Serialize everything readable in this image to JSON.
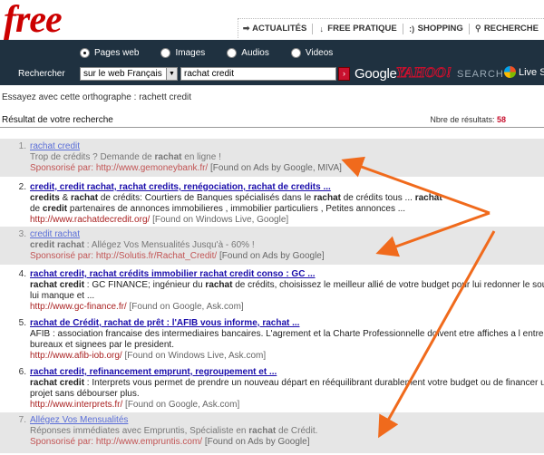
{
  "header": {
    "logo": "free",
    "nav": [
      {
        "icon": "arrow-right-icon",
        "glyph": "➡",
        "label": "ACTUALITÉS"
      },
      {
        "icon": "arrow-down-icon",
        "glyph": "↓",
        "label": "FREE PRATIQUE"
      },
      {
        "icon": "smiley-icon",
        "glyph": ":)",
        "label": "SHOPPING"
      },
      {
        "icon": "pin-icon",
        "glyph": "⚲",
        "label": "RECHERCHE"
      }
    ]
  },
  "search": {
    "tabs": [
      "Pages web",
      "Images",
      "Audios",
      "Videos"
    ],
    "selected_tab": "Pages web",
    "label": "Rechercher",
    "scope": "sur le web Français",
    "query": "rachat credit",
    "go": "›",
    "engines": {
      "google": "Google",
      "yahoo": "YAHOO!",
      "yahoo_search": "SEARCH",
      "live": "Live Se"
    }
  },
  "suggestion": "Essayez avec cette orthographe : rachett credit",
  "results_header": {
    "title": "Résultat de votre recherche",
    "count_label": "Nbre de résultats:",
    "count": "58"
  },
  "results": [
    {
      "num": "1.",
      "sponsored": true,
      "title": "rachat credit",
      "lines": [
        "Trop de crédits ? Demande de <b>rachat</b> en ligne !"
      ],
      "url": "Sponsorisé par: http://www.gemoneybank.fr/",
      "source": "[Found on Ads by Google, MIVA]"
    },
    {
      "num": "2.",
      "sponsored": false,
      "title": "credit, credit rachat, rachat credits, renégociation, rachat de credits ...",
      "lines": [
        "<b>credits</b> &amp; <b>rachat</b> de crédits: Courtiers de Banques spécialisés dans le <b>rachat</b> de crédits tous ... <b>rachat</b>",
        "de <b>credit</b> partenaires de annonces immobilieres , immobilier particuliers , Petites annonces ..."
      ],
      "url": "http://www.rachatdecredit.org/",
      "source": "[Found on Windows Live, Google]"
    },
    {
      "num": "3.",
      "sponsored": true,
      "title": "credit rachat",
      "lines": [
        "<b>credit rachat</b> : Allégez Vos Mensualités Jusqu'à - 60% !"
      ],
      "url": "Sponsorisé par: http://Solutis.fr/Rachat_Credit/",
      "source": "[Found on Ads by Google]"
    },
    {
      "num": "4.",
      "sponsored": false,
      "title": "rachat credit, rachat crédits immobilier rachat credit conso : GC ...",
      "lines": [
        "<b>rachat credit</b> : GC FINANCE; ingénieur du <b>rachat</b> de crédits, choisissez le meilleur allié de votre budget pour lui redonner le souffle qu'il",
        "lui manque et ..."
      ],
      "url": "http://www.gc-finance.fr/",
      "source": "[Found on Google, Ask.com]"
    },
    {
      "num": "5.",
      "sponsored": false,
      "title": "rachat de Crédit, rachat de prêt : l'AFIB vous informe, rachat ...",
      "lines": [
        "AFIB : association francaise des intermediaires bancaires. L'agrement et la Charte Professionnelle doivent etre affiches a l entree des",
        "bureaux et signees par le president."
      ],
      "url": "http://www.afib-iob.org/",
      "source": "[Found on Windows Live, Ask.com]"
    },
    {
      "num": "6.",
      "sponsored": false,
      "title": "rachat credit, refinancement emprunt, regroupement et ...",
      "lines": [
        "<b>rachat credit</b> : Interprets vous permet de prendre un nouveau départ en rééquilibrant durablement votre budget ou de financer un",
        "projet sans débourser plus."
      ],
      "url": "http://www.interprets.fr/",
      "source": "[Found on Google, Ask.com]"
    },
    {
      "num": "7.",
      "sponsored": true,
      "title": "Allégez Vos Mensualités",
      "lines": [
        "Réponses immédiates avec Empruntis, Spécialiste en <b>rachat</b> de Crédit."
      ],
      "url": "Sponsorisé par: http://www.empruntis.com/",
      "source": "[Found on Ads by Google]"
    }
  ],
  "colors": {
    "brand_red": "#cc0000",
    "bar_bg": "#1f3140",
    "link": "#1a0dab",
    "sponsored_bg": "#e6e6e6",
    "annotation_arrow": "#f06a1c"
  }
}
